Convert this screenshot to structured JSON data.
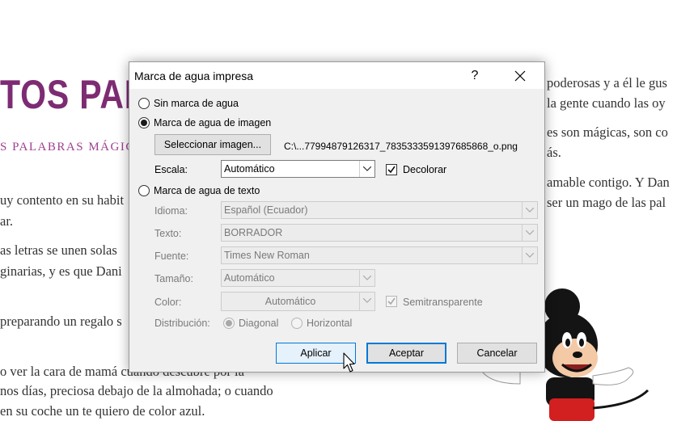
{
  "document": {
    "title": "TOS PAR",
    "subtitle": "S PALABRAS MÁGICA",
    "left_lines": [
      "uy contento en su habit",
      "ar.",
      "as letras se unen solas",
      "ginarias, y es que Dani",
      "preparando un regalo s",
      "o ver la cara de mamá cuando descubre por la",
      "nos días, preciosa debajo de la almohada; o cuando",
      "en su coche un te quiero de color azul."
    ],
    "right_lines": [
      "poderosas y a él le gus",
      "la gente cuando las oy",
      "es son mágicas, son co",
      "ás.",
      "amable contigo. Y Dan",
      "ser un mago de las pal"
    ]
  },
  "dialog": {
    "title": "Marca de agua impresa",
    "help_label": "?",
    "no_watermark_label": "Sin marca de agua",
    "picture_watermark_label": "Marca de agua de imagen",
    "select_picture_label": "Seleccionar imagen...",
    "picture_path": "C:\\...77994879126317_7835333591397685868_o.png",
    "scale_label": "Escala:",
    "scale_value": "Automático",
    "washout_label": "Decolorar",
    "washout_checked": true,
    "text_watermark_label": "Marca de agua de texto",
    "language_label": "Idioma:",
    "language_value": "Español (Ecuador)",
    "text_label": "Texto:",
    "text_value": "BORRADOR",
    "font_label": "Fuente:",
    "font_value": "Times New Roman",
    "size_label": "Tamaño:",
    "size_value": "Automático",
    "color_label": "Color:",
    "color_value": "Automático",
    "semitransparent_label": "Semitransparente",
    "layout_label": "Distribución:",
    "diagonal_label": "Diagonal",
    "horizontal_label": "Horizontal",
    "apply_label": "Aplicar",
    "ok_label": "Aceptar",
    "cancel_label": "Cancelar",
    "selected_option": "picture"
  },
  "colors": {
    "title_purple": "#7d2b73",
    "focus_blue": "#0078d7"
  }
}
